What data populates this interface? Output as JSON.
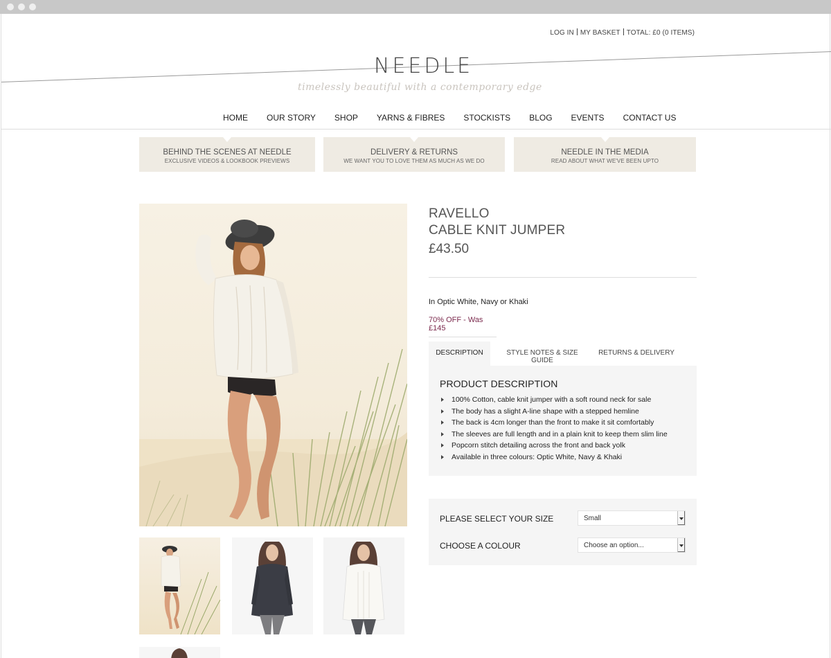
{
  "header": {
    "top_links": [
      "LOG IN",
      "MY BASKET",
      "TOTAL: £0 (0 ITEMS)"
    ],
    "logo": "NEEDLE",
    "tagline": "timelessly beautiful with a contemporary edge"
  },
  "nav": {
    "items": [
      "HOME",
      "OUR STORY",
      "SHOP",
      "YARNS & FIBRES",
      "STOCKISTS",
      "BLOG",
      "EVENTS",
      "CONTACT US"
    ]
  },
  "promos": [
    {
      "title": "BEHIND THE SCENES AT NEEDLE",
      "subtitle": "EXCLUSIVE VIDEOS & LOOKBOOK PREVIEWS"
    },
    {
      "title": "DELIVERY & RETURNS",
      "subtitle": "WE WANT YOU TO LOVE THEM AS MUCH AS WE DO"
    },
    {
      "title": "NEEDLE IN THE MEDIA",
      "subtitle": "READ ABOUT WHAT WE'VE BEEN UPTO"
    }
  ],
  "product": {
    "title_line1": "RAVELLO",
    "title_line2": "CABLE KNIT JUMPER",
    "price": "£43.50",
    "colours_note": "In Optic White, Navy or Khaki",
    "offer": "70% OFF - Was £145"
  },
  "tabs": [
    "DESCRIPTION",
    "STYLE NOTES & SIZE GUIDE",
    "RETURNS & DELIVERY"
  ],
  "description": {
    "heading": "PRODUCT DESCRIPTION",
    "items": [
      "100% Cotton, cable knit jumper with a soft round neck for sale",
      "The body has a slight A-line shape with a stepped hemline",
      "The back is 4cm longer than the front to make it sit comfortably",
      "The sleeves are full length and in a plain knit to keep them slim line",
      "Popcorn stitch detailing across the front and back yolk",
      "Available in three colours: Optic White, Navy & Khaki"
    ]
  },
  "options": {
    "size_label": "PLEASE SELECT YOUR SIZE",
    "size_value": "Small",
    "colour_label": "CHOOSE A COLOUR",
    "colour_value": "Choose an option..."
  },
  "colors": {
    "promo_bg": "#efebe3",
    "offer_text": "#7b2a4d",
    "panel_bg": "#f5f5f5"
  }
}
